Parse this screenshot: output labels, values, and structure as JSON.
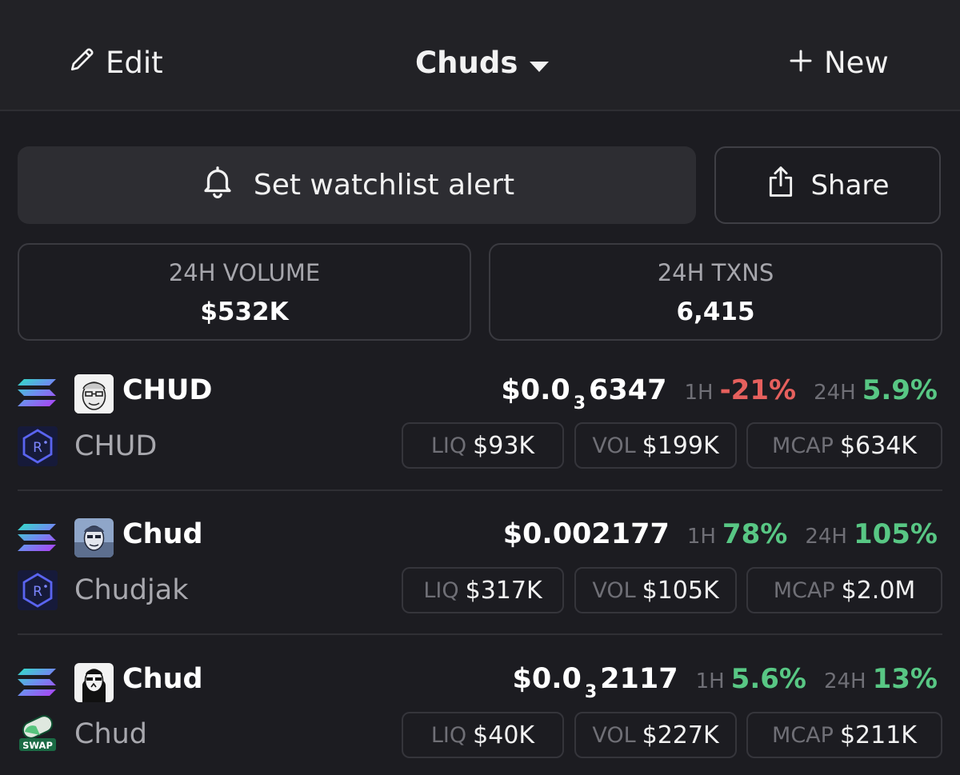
{
  "header": {
    "edit_label": "Edit",
    "watchlist_name": "Chuds",
    "new_label": "New"
  },
  "actions": {
    "alert_label": "Set watchlist alert",
    "share_label": "Share"
  },
  "stats": {
    "volume_label": "24H VOLUME",
    "volume_value": "$532K",
    "txns_label": "24H TXNS",
    "txns_value": "6,415"
  },
  "labels": {
    "h1": "1H",
    "h24": "24H",
    "liq": "LIQ",
    "vol": "VOL",
    "mcap": "MCAP"
  },
  "tokens": [
    {
      "symbol": "CHUD",
      "name": "CHUD",
      "chain_icon": "solana-icon",
      "dex_icon": "raydium-icon",
      "price_prefix": "$0.0",
      "price_zeros": "3",
      "price_rest": "6347",
      "change_1h": "-21%",
      "change_24h": "5.9%",
      "liq": "$93K",
      "vol": "$199K",
      "mcap": "$634K"
    },
    {
      "symbol": "Chud",
      "name": "Chudjak",
      "chain_icon": "solana-icon",
      "dex_icon": "raydium-icon",
      "price_prefix": "$0.002177",
      "price_zeros": "",
      "price_rest": "",
      "change_1h": "78%",
      "change_24h": "105%",
      "liq": "$317K",
      "vol": "$105K",
      "mcap": "$2.0M"
    },
    {
      "symbol": "Chud",
      "name": "Chud",
      "chain_icon": "solana-icon",
      "dex_icon": "pumpswap-icon",
      "dex_icon_text": "SWAP",
      "price_prefix": "$0.0",
      "price_zeros": "3",
      "price_rest": "2117",
      "change_1h": "5.6%",
      "change_24h": "13%",
      "liq": "$40K",
      "vol": "$227K",
      "mcap": "$211K"
    }
  ],
  "colors": {
    "background": "#1c1c21",
    "positive": "#58c784",
    "negative": "#e6605d",
    "muted": "#6f6f76"
  }
}
